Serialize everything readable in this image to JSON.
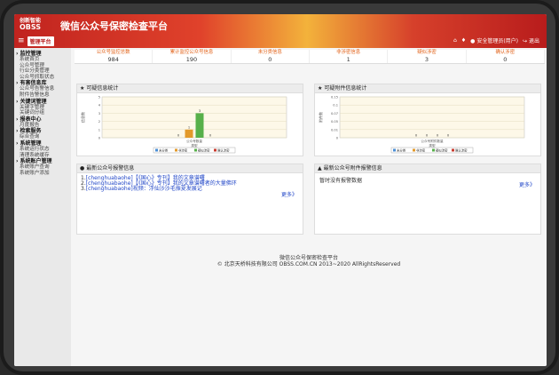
{
  "header": {
    "logo_small": "创新智能",
    "logo_brand": "OBSS",
    "title": "微信公众号保密检查平台",
    "menu_label": "管理平台",
    "home_icon": "home-icon",
    "bell_icon": "bell-icon",
    "user_label": "安全管理员(用户)",
    "logout_label": "退出"
  },
  "sidebar": {
    "groups": [
      {
        "title": "监控管理",
        "items": [
          "系统首页",
          "公众号管理",
          "行业分类管理",
          "公众号抓取状态"
        ]
      },
      {
        "title": "有害信息库",
        "items": [
          "公众号告警信息",
          "附件告警信息"
        ]
      },
      {
        "title": "关键词管理",
        "items": [
          "关键字管理",
          "关键词分组"
        ]
      },
      {
        "title": "报表中心",
        "items": [
          "月度报告"
        ]
      },
      {
        "title": "检索服务",
        "items": [
          "综合查询"
        ]
      },
      {
        "title": "系统管理",
        "items": [
          "系统运行状态",
          "清理系统缓存"
        ]
      },
      {
        "title": "系统账户管理",
        "items": [
          "系统账户查询",
          "系统账户添加"
        ]
      }
    ]
  },
  "stats": [
    {
      "label": "公众号监控总数",
      "value": "984"
    },
    {
      "label": "累计监控公众号信息",
      "value": "190"
    },
    {
      "label": "未分类信息",
      "value": "0"
    },
    {
      "label": "非涉密信息",
      "value": "1"
    },
    {
      "label": "疑似涉密",
      "value": "3"
    },
    {
      "label": "确认涉密",
      "value": "0"
    }
  ],
  "panels": {
    "suspicious_title": "可疑信息统计",
    "attachment_title": "可疑附件信息统计",
    "news_title": "最新公众号报警信息",
    "news_items": [
      {
        "num": "1.",
        "text": "[chenghuabaohe]【《国心》专刊】我的文章谱曙"
      },
      {
        "num": "2.",
        "text": "[chenghuabaohe]【《国心》专刊】我的文章谱曙者的大量佛环"
      },
      {
        "num": "3.",
        "text": "[chenghuabaohe]视频：浮仙沙沙毛振夏发展记"
      }
    ],
    "news_more": "更多》",
    "attach_news_title": "最新公众号附件报警信息",
    "attach_empty": "暂时没有报警数据",
    "attach_more": "更多》"
  },
  "footer": {
    "line1": "微信公众号保密检查平台",
    "line2": "© 北京天桥科技有限公司 OBSS.COM.CN 2013~2020 AllRightsReserved"
  },
  "chart_data": [
    {
      "type": "bar",
      "title": "",
      "categories": [
        "公众号数量"
      ],
      "series": [
        {
          "name": "未分类",
          "values": [
            0
          ],
          "color": "#4b8fd6"
        },
        {
          "name": "非涉密",
          "values": [
            1
          ],
          "color": "#e39a2b"
        },
        {
          "name": "疑似涉密",
          "values": [
            3
          ],
          "color": "#57b04a"
        },
        {
          "name": "确认涉密",
          "values": [
            0
          ],
          "color": "#c93b2f"
        }
      ],
      "xlabel": "类型",
      "ylabel": "信息数",
      "ylim": [
        0,
        5
      ],
      "yticks": [
        "0",
        "1",
        "2",
        "3",
        "4",
        "5"
      ],
      "grid": true,
      "legend": "bottom"
    },
    {
      "type": "bar",
      "title": "",
      "categories": [
        "公众号附件数量"
      ],
      "series": [
        {
          "name": "未分类",
          "values": [
            0
          ],
          "color": "#4b8fd6"
        },
        {
          "name": "非涉密",
          "values": [
            0
          ],
          "color": "#e39a2b"
        },
        {
          "name": "疑似涉密",
          "values": [
            0
          ],
          "color": "#57b04a"
        },
        {
          "name": "确认涉密",
          "values": [
            0
          ],
          "color": "#c93b2f"
        }
      ],
      "xlabel": "类型",
      "ylabel": "附件数",
      "ylim": [
        0,
        0.15
      ],
      "yticks": [
        "0",
        "0.01",
        "0.05",
        "0.07",
        "0.1",
        "0.15"
      ],
      "grid": true,
      "legend": "bottom"
    }
  ]
}
